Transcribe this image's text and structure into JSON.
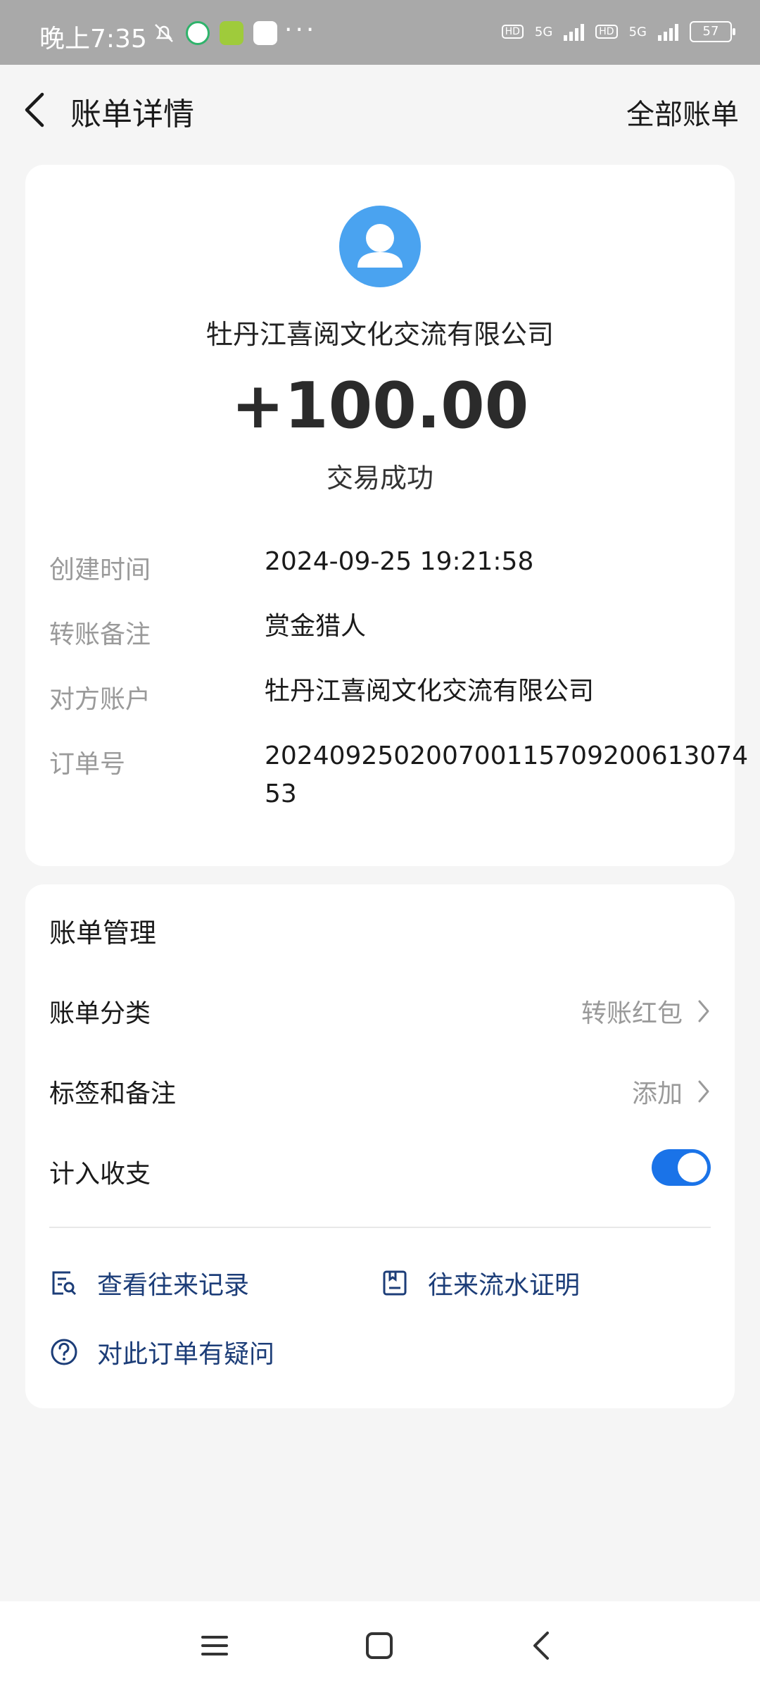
{
  "status_bar": {
    "time": "晚上7:35",
    "network_1": "5G",
    "network_2": "5G",
    "hd_1": "HD",
    "hd_2": "HD",
    "battery": "57",
    "more": "···"
  },
  "header": {
    "title": "账单详情",
    "right_action": "全部账单"
  },
  "transaction": {
    "merchant": "牡丹江喜阅文化交流有限公司",
    "amount": "+100.00",
    "status": "交易成功",
    "details": [
      {
        "label": "创建时间",
        "value": "2024-09-25 19:21:58"
      },
      {
        "label": "转账备注",
        "value": "赏金猎人"
      },
      {
        "label": "对方账户",
        "value": "牡丹江喜阅文化交流有限公司"
      },
      {
        "label": "订单号",
        "value": "20240925020070011570920061307453"
      }
    ]
  },
  "management": {
    "title": "账单管理",
    "category_label": "账单分类",
    "category_value": "转账红包",
    "tag_label": "标签和备注",
    "tag_value": "添加",
    "include_label": "计入收支",
    "include_enabled": true,
    "links": {
      "history": "查看往来记录",
      "statement": "往来流水证明",
      "question": "对此订单有疑问"
    }
  },
  "colors": {
    "accent": "#1a73e8",
    "avatar": "#4aa3f0",
    "link": "#1c3d78"
  }
}
